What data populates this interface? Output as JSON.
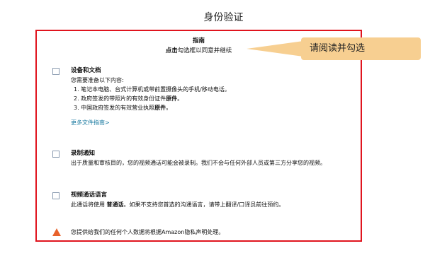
{
  "page": {
    "title": "身份验证"
  },
  "guide": {
    "title": "指南",
    "sub_bold": "点击",
    "sub_rest": "勾选框以同意并继续"
  },
  "callout": {
    "text": "请阅读并勾选"
  },
  "sections": {
    "documents": {
      "title": "设备和文档",
      "intro": "您需要准备以下内容:",
      "items": [
        {
          "text": "1. 笔记本电脑、台式计算机或带前置摄像头的手机/移动电话。",
          "bold": ""
        },
        {
          "text": "2. 政府签发的带照片的有效身份证件",
          "bold": "原件",
          "tail": "。"
        },
        {
          "text": "3. 中国政府签发的有效营业执照",
          "bold": "原件",
          "tail": "。"
        }
      ],
      "more_link": "更多文件指南>"
    },
    "recording": {
      "title": "录制通知",
      "text": "出于质量和审核目的，您的视频通话可能会被录制。我们不会与任何外部人员或第三方分享您的视频。"
    },
    "language": {
      "title": "视频通话语言",
      "text_a": "此通话将使用 ",
      "text_bold": "普通话",
      "text_b": "。如果不支持您首选的沟通语言，请带上翻译/口译员前往预约。"
    }
  },
  "privacy": {
    "icon": "warning-icon",
    "text": "您提供给我们的任何个人数据将根据Amazon隐私声明处理。"
  },
  "colors": {
    "frame_border": "#e0141e",
    "callout_bg": "#f7cf91",
    "link": "#1a7aa0",
    "warning": "#e8622b"
  }
}
